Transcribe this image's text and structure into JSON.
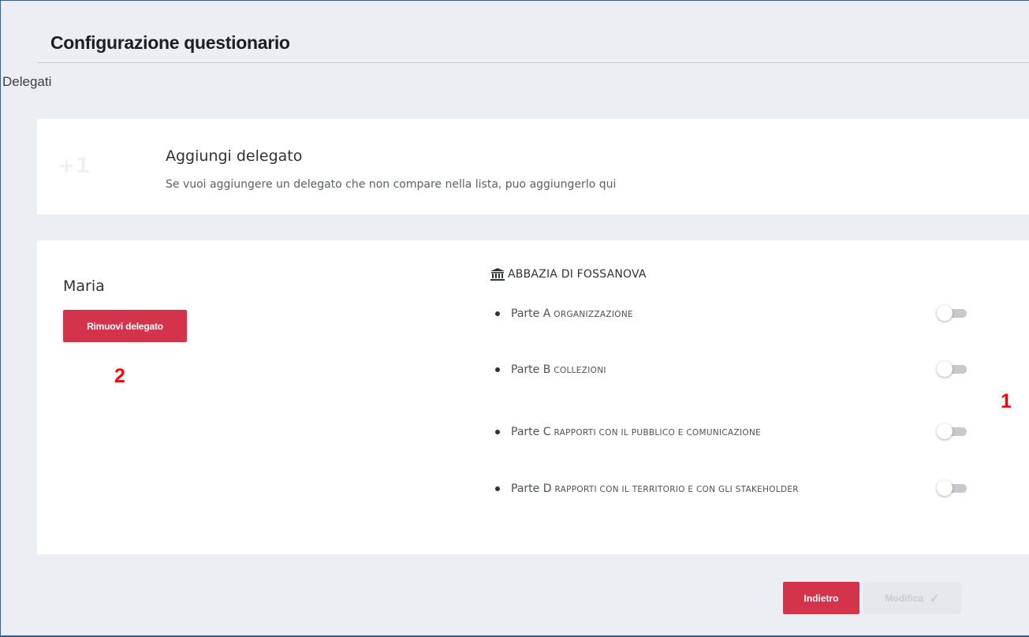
{
  "page": {
    "title": "Configurazione questionario",
    "section_label": "Delegati"
  },
  "add_delegate": {
    "badge": "+1",
    "title": "Aggiungi delegato",
    "description": "Se vuoi aggiungere un delegato che non compare nella lista, puo aggiungerlo qui"
  },
  "delegate": {
    "name": "Maria",
    "remove_label": "Rimuovi delegato",
    "museum": {
      "icon": "museum-icon",
      "name": "ABBAZIA DI FOSSANOVA"
    },
    "parts": [
      {
        "prefix": "Parte A",
        "name": "organizzazione",
        "enabled": false
      },
      {
        "prefix": "Parte B",
        "name": "collezioni",
        "enabled": false
      },
      {
        "prefix": "Parte C",
        "name": "rapporti con il pubblico e comunicazione",
        "enabled": false
      },
      {
        "prefix": "Parte D",
        "name": "rapporti con il territorio e con gli stakeholder",
        "enabled": false
      }
    ]
  },
  "footer": {
    "back_label": "Indietro",
    "modify_label": "Modifica",
    "modify_icon": "check-icon"
  },
  "callouts": {
    "one": "1",
    "two": "2"
  },
  "colors": {
    "accent": "#d3344b",
    "callout": "#ff0000",
    "background": "#ebeef2"
  }
}
